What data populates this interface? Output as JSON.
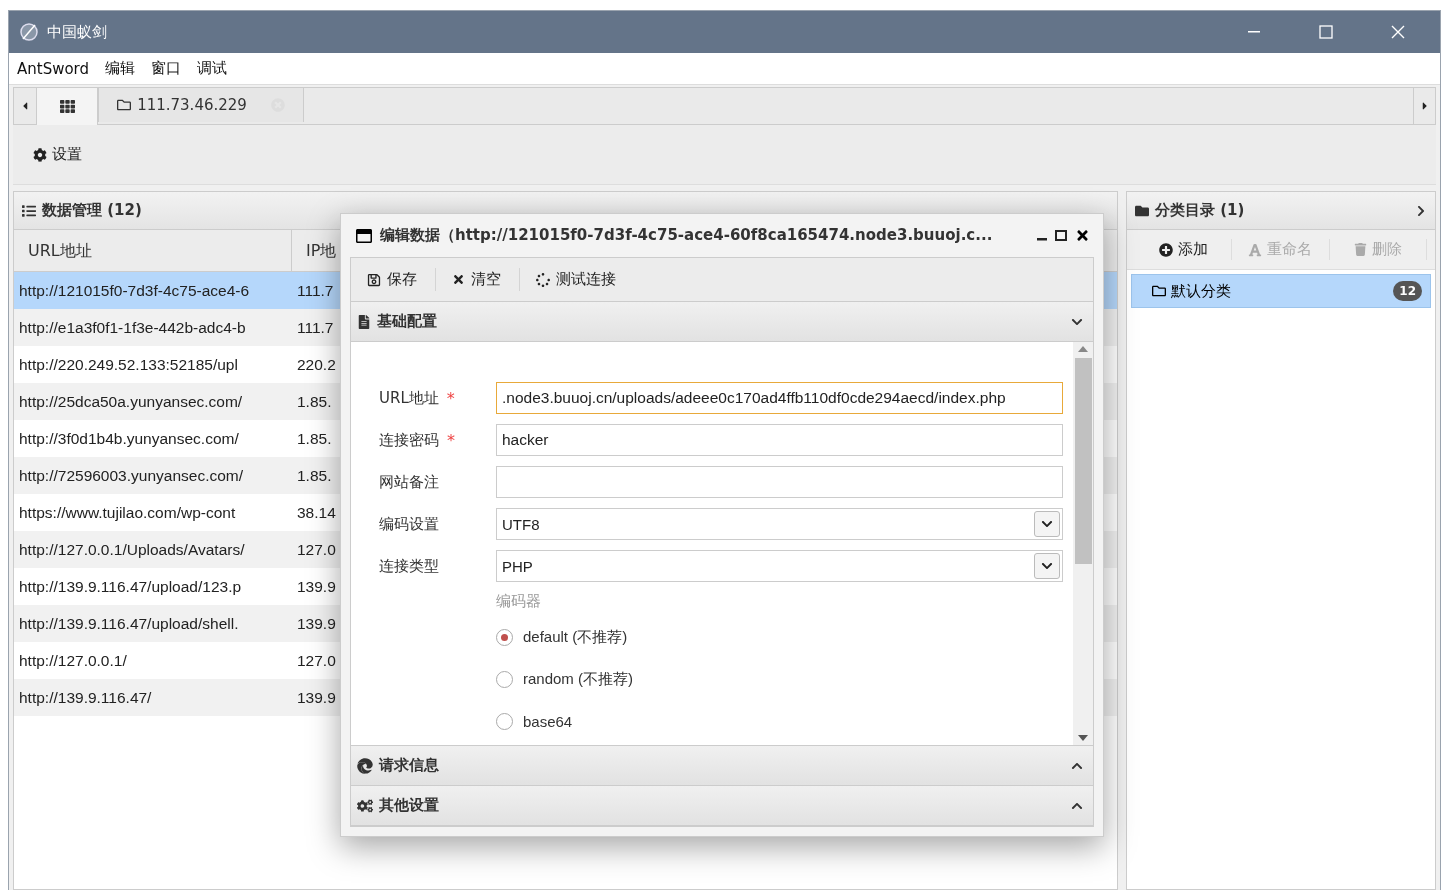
{
  "window": {
    "title": "中国蚁剑"
  },
  "menu": [
    "AntSword",
    "编辑",
    "窗口",
    "调试"
  ],
  "tabs": [
    {
      "kind": "home",
      "selected": true
    },
    {
      "kind": "folder",
      "label": "111.73.46.229",
      "selected": false
    }
  ],
  "toolbar": [
    {
      "label": "设置"
    }
  ],
  "data_panel": {
    "title": "数据管理 (12)",
    "columns": [
      "URL地址",
      "IP地"
    ],
    "rows": [
      {
        "url": "http://121015f0-7d3f-4c75-ace4-6",
        "ip": "111.7",
        "selected": true
      },
      {
        "url": "http://e1a3f0f1-1f3e-442b-adc4-b",
        "ip": "111.7",
        "selected": false
      },
      {
        "url": "http://220.249.52.133:52185/upl",
        "ip": "220.2",
        "selected": false
      },
      {
        "url": "http://25dca50a.yunyansec.com/",
        "ip": "1.85.",
        "selected": false
      },
      {
        "url": "http://3f0d1b4b.yunyansec.com/",
        "ip": "1.85.",
        "selected": false
      },
      {
        "url": "http://72596003.yunyansec.com/",
        "ip": "1.85.",
        "selected": false
      },
      {
        "url": "https://www.tujilao.com/wp-cont",
        "ip": "38.14",
        "selected": false
      },
      {
        "url": "http://127.0.0.1/Uploads/Avatars/",
        "ip": "127.0",
        "selected": false
      },
      {
        "url": "http://139.9.116.47/upload/123.p",
        "ip": "139.9",
        "selected": false
      },
      {
        "url": "http://139.9.116.47/upload/shell.",
        "ip": "139.9",
        "selected": false
      },
      {
        "url": "http://127.0.0.1/",
        "ip": "127.0",
        "selected": false
      },
      {
        "url": "http://139.9.116.47/",
        "ip": "139.9",
        "selected": false
      }
    ]
  },
  "category_panel": {
    "title": "分类目录 (1)",
    "actions": [
      {
        "kind": "add",
        "label": "添加",
        "disabled": false
      },
      {
        "kind": "rename",
        "label": "重命名",
        "disabled": true
      },
      {
        "kind": "delete",
        "label": "删除",
        "disabled": true
      }
    ],
    "items": [
      {
        "label": "默认分类",
        "count": "12",
        "selected": true
      }
    ]
  },
  "dialog": {
    "title": "编辑数据（http://121015f0-7d3f-4c75-ace4-60f8ca165474.node3.buuoj.c...",
    "toolbar": [
      {
        "kind": "save",
        "label": "保存"
      },
      {
        "kind": "clear",
        "label": "清空"
      },
      {
        "kind": "test",
        "label": "测试连接"
      }
    ],
    "sections": [
      {
        "kind": "basic",
        "title": "基础配置",
        "expanded": true
      },
      {
        "kind": "request",
        "title": "请求信息",
        "expanded": false
      },
      {
        "kind": "other",
        "title": "其他设置",
        "expanded": false
      }
    ],
    "fields": [
      {
        "kind": "text",
        "label": "URL地址",
        "required_mark": "*",
        "value": ".node3.buuoj.cn/uploads/adeee0c170ad4ffb110df0cde294aecd/index.php",
        "focused": true
      },
      {
        "kind": "text",
        "label": "连接密码",
        "required_mark": "*",
        "value": "hacker",
        "focused": false
      },
      {
        "kind": "text",
        "label": "网站备注",
        "focused": false
      },
      {
        "kind": "select",
        "label": "编码设置",
        "value": "UTF8"
      },
      {
        "kind": "select",
        "label": "连接类型",
        "value": "PHP"
      }
    ],
    "encoder": {
      "label": "编码器",
      "options": [
        {
          "label": "default (不推荐)",
          "selected": true
        },
        {
          "label": "random (不推荐)",
          "selected": false
        },
        {
          "label": "base64",
          "selected": false
        }
      ]
    }
  }
}
